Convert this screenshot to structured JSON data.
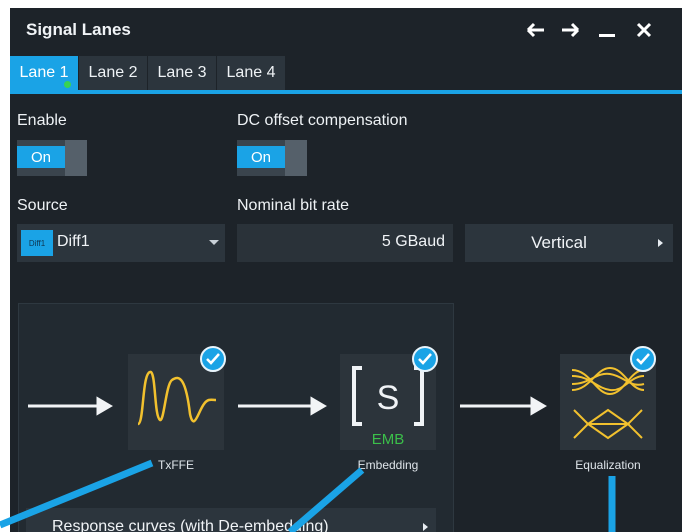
{
  "window": {
    "title": "Signal Lanes"
  },
  "titlebar_icons": [
    "arrow-left-icon",
    "arrow-right-icon",
    "minimize-icon",
    "close-icon"
  ],
  "tabs": [
    {
      "label": "Lane 1",
      "active": true,
      "status": "green"
    },
    {
      "label": "Lane 2",
      "active": false
    },
    {
      "label": "Lane 3",
      "active": false
    },
    {
      "label": "Lane 4",
      "active": false
    }
  ],
  "enable": {
    "label": "Enable",
    "value": "On"
  },
  "dc_offset": {
    "label": "DC offset compensation",
    "value": "On"
  },
  "source": {
    "label": "Source",
    "icon_text": "Diff1",
    "value": "Diff1"
  },
  "bitrate": {
    "label": "Nominal bit rate",
    "value": "5 GBaud"
  },
  "vertical": {
    "label": "Vertical"
  },
  "blocks": [
    {
      "label": "TxFFE",
      "checked": true
    },
    {
      "label": "Embedding",
      "emb_text": "EMB",
      "s_text": "S",
      "checked": true
    },
    {
      "label": "Equalization",
      "checked": true
    }
  ],
  "response": {
    "label": "Response curves (with De-embedding)"
  },
  "colors": {
    "accent": "#1aa3e6",
    "panel": "#1d2329",
    "trace": "#f2c12e",
    "status_green": "#39d353"
  }
}
